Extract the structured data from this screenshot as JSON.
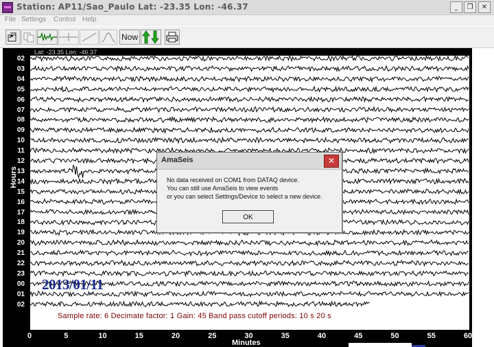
{
  "window": {
    "title": "Station: AP11/Sao_Paulo Lat: -23.35 Lon: -46.37",
    "minimize_glyph": "_",
    "restore_glyph": "❐",
    "close_glyph": "✕"
  },
  "menu": {
    "items": [
      "File",
      "Settings",
      "Control",
      "Help"
    ]
  },
  "toolbar": {
    "now_label": "Now",
    "icons": [
      "open-file-icon",
      "copy-icon",
      "waveform-icon",
      "pick-icon",
      "slope-icon",
      "spectrum-icon",
      "up-down-arrows-icon",
      "print-icon"
    ]
  },
  "plot": {
    "latlon_label": "Lat: -23.35 Lon: -46.37",
    "hours_title": "Hours",
    "hour_labels": [
      "02",
      "03",
      "04",
      "05",
      "06",
      "07",
      "08",
      "09",
      "10",
      "11",
      "12",
      "13",
      "14",
      "15",
      "16",
      "17",
      "18",
      "19",
      "20",
      "21",
      "22",
      "23",
      "00",
      "01",
      "02"
    ],
    "date_stamp": "2013/01/11",
    "info_line": "Sample rate: 6   Decimate factor: 1   Gain: 45   Band pass cutoff periods: 10 s 20 s",
    "minutes_title": "Minutes",
    "minute_ticks": [
      "0",
      "5",
      "10",
      "15",
      "20",
      "25",
      "30",
      "35",
      "40",
      "45",
      "50",
      "55",
      "60"
    ],
    "trace_color": "#000000",
    "background_color": "#000000",
    "date_color": "#1a2a88",
    "info_color": "#7a0000",
    "event_hour": "13",
    "event_minute": 6.5
  },
  "dialog": {
    "title": "AmaSeis",
    "close_glyph": "✕",
    "lines": [
      "No data received on COM1 from DATAQ device.",
      "You can still use AmaSeis to view events",
      "or you can select Settings/Device to select a new device."
    ],
    "ok_label": "OK"
  }
}
